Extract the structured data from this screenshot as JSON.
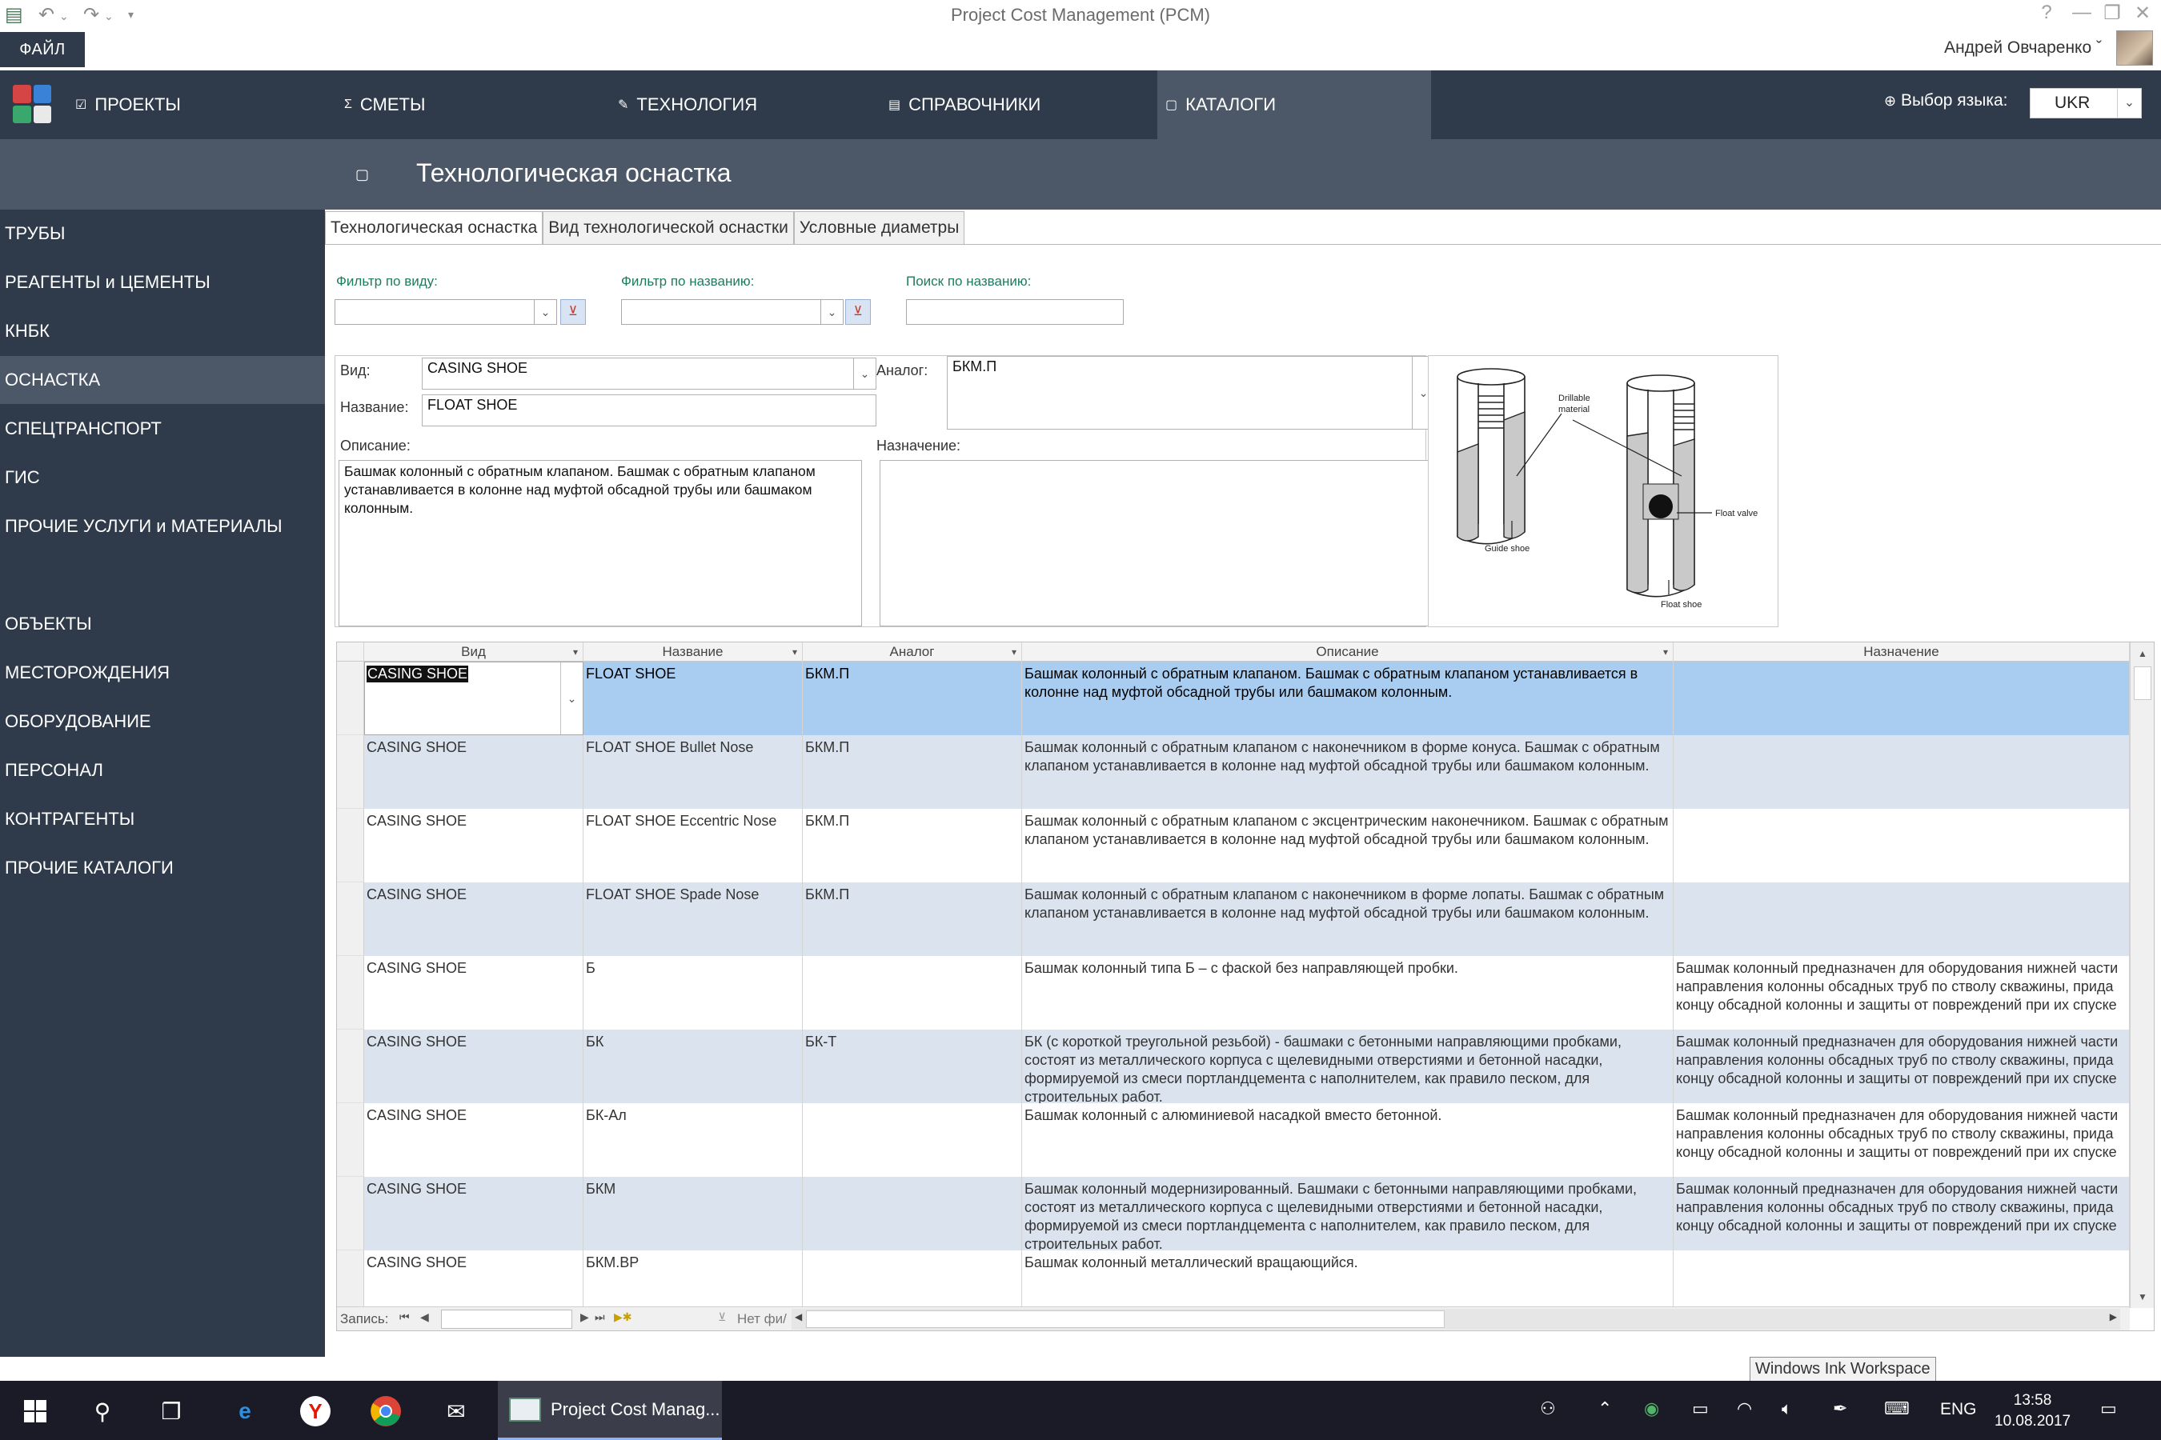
{
  "window": {
    "title": "Project Cost Management (PCM)",
    "controls": [
      "?",
      "—",
      "❐",
      "✕"
    ]
  },
  "ribbon": {
    "file_tab": "ФАЙЛ",
    "user_name": "Андрей Овчаренко ˇ"
  },
  "nav": {
    "items": [
      {
        "label": "ПРОЕКТЫ",
        "icon": "check-icon"
      },
      {
        "label": "СМЕТЫ",
        "icon": "sigma-icon"
      },
      {
        "label": "ТЕХНОЛОГИЯ",
        "icon": "pencil-icon"
      },
      {
        "label": "СПРАВОЧНИКИ",
        "icon": "document-icon"
      },
      {
        "label": "КАТАЛОГИ",
        "icon": "folder-icon"
      }
    ],
    "active": "КАТАЛОГИ",
    "language_label": "Выбор языка:",
    "language_value": "UKR"
  },
  "section": {
    "title": "Технологическая оснастка"
  },
  "sidebar": {
    "items": [
      "ТРУБЫ",
      "РЕАГЕНТЫ и ЦЕМЕНТЫ",
      "КНБК",
      "ОСНАСТКА",
      "СПЕЦТРАНСПОРТ",
      "ГИС",
      "ПРОЧИЕ УСЛУГИ и МАТЕРИАЛЫ",
      "ОБЪЕКТЫ",
      "МЕСТОРОЖДЕНИЯ",
      "ОБОРУДОВАНИЕ",
      "ПЕРСОНАЛ",
      "КОНТРАГЕНТЫ",
      "ПРОЧИЕ КАТАЛОГИ"
    ],
    "active": "ОСНАСТКА"
  },
  "tabs": [
    "Технологическая оснастка",
    "Вид технологической оснастки",
    "Условные диаметры"
  ],
  "filters": {
    "by_type_label": "Фильтр по виду:",
    "by_name_label": "Фильтр по названию:",
    "search_label": "Поиск по названию:",
    "by_type_value": "",
    "by_name_value": "",
    "search_value": ""
  },
  "detail": {
    "type_label": "Вид:",
    "type_value": "CASING SHOE",
    "name_label": "Название:",
    "name_value": "FLOAT SHOE",
    "analog_label": "Аналог:",
    "analog_value": "БКМ.П",
    "description_label": "Описание:",
    "description_value": "Башмак колонный с обратным клапаном. Башмак с обратным клапаном устанавливается в колонне над муфтой обсадной трубы или  башмаком колонным.",
    "purpose_label": "Назначение:",
    "purpose_value": ""
  },
  "illustration": {
    "labels": [
      "Drillable material",
      "Float valve",
      "Guide shoe",
      "Float shoe"
    ]
  },
  "grid": {
    "columns": [
      "Вид",
      "Название",
      "Аналог",
      "Описание",
      "Назначение"
    ],
    "rows": [
      {
        "type": "CASING SHOE",
        "name": "FLOAT SHOE",
        "analog": "БКМ.П",
        "description": "Башмак колонный с обратным клапаном. Башмак с обратным клапаном устанавливается в колонне над муфтой обсадной трубы или башмаком колонным.",
        "purpose": ""
      },
      {
        "type": "CASING SHOE",
        "name": "FLOAT SHOE Bullet Nose",
        "analog": "БКМ.П",
        "description": "Башмак колонный с обратным клапаном с наконечником в форме конуса. Башмак с обратным клапаном устанавливается в колонне над муфтой обсадной трубы или башмаком  колонным.",
        "purpose": ""
      },
      {
        "type": "CASING SHOE",
        "name": "FLOAT SHOE Eccentric Nose",
        "analog": "БКМ.П",
        "description": "Башмак колонный с обратным клапаном с эксцентрическим наконечником. Башмак с обратным клапаном устанавливается в колонне над муфтой обсадной трубы или башмаком  колонным.",
        "purpose": ""
      },
      {
        "type": "CASING SHOE",
        "name": "FLOAT SHOE Spade Nose",
        "analog": "БКМ.П",
        "description": "Башмак колонный с обратным клапаном с наконечником в форме лопаты. Башмак с обратным клапаном устанавливается в колонне над муфтой обсадной трубы или башмаком  колонным.",
        "purpose": ""
      },
      {
        "type": "CASING SHOE",
        "name": "Б",
        "analog": "",
        "description": "Башмак колонный типа Б – с фаской без направляющей пробки.",
        "purpose": "Башмак колонный предназначен для оборудования нижней части направления колонны обсадных труб по стволу скважины, прида концу обсадной колонны и защиты от повреждений при их спуске"
      },
      {
        "type": "CASING SHOE",
        "name": "БК",
        "analog": "БК-Т",
        "description": "БК (с короткой треугольной резьбой)  - башмаки с бетонными направляющими пробками, состоят из металлического корпуса с щелевидными отверстиями и бетонной насадки, формируемой из смеси портландцемента с наполнителем, как правило песком, для строительных работ.",
        "purpose": "Башмак колонный предназначен для оборудования нижней части направления колонны обсадных труб по стволу скважины, прида концу обсадной колонны и защиты от повреждений при их спуске"
      },
      {
        "type": "CASING SHOE",
        "name": "БК-Ал",
        "analog": "",
        "description": "Башмак колонный с алюминиевой насадкой вместо бетонной.",
        "purpose": "Башмак колонный предназначен для оборудования нижней части направления колонны обсадных труб по стволу скважины, прида концу обсадной колонны и защиты от повреждений при их спуске"
      },
      {
        "type": "CASING SHOE",
        "name": "БКМ",
        "analog": "",
        "description": "Башмак колонный модернизированный. Башмаки с бетонными направляющими пробками, состоят из металлического корпуса с щелевидными отверстиями и бетонной насадки, формируемой из смеси портландцемента с наполнителем, как правило песком, для строительных работ.",
        "purpose": "Башмак колонный предназначен для оборудования нижней части направления колонны обсадных труб по стволу скважины, прида концу обсадной колонны и защиты от повреждений при их спуске"
      },
      {
        "type": "CASING SHOE",
        "name": "БКМ.ВР",
        "analog": "",
        "description": "Башмак колонный металлический вращающийся.",
        "purpose": ""
      }
    ],
    "selected_index": 0,
    "record_label": "Запись:",
    "record_value": "",
    "filter_label": "Нет фи/"
  },
  "taskbar": {
    "tooltip": "Windows Ink Workspace",
    "app_label": "Project Cost Manag...",
    "lang": "ENG",
    "time": "13:58",
    "date": "10.08.2017"
  }
}
